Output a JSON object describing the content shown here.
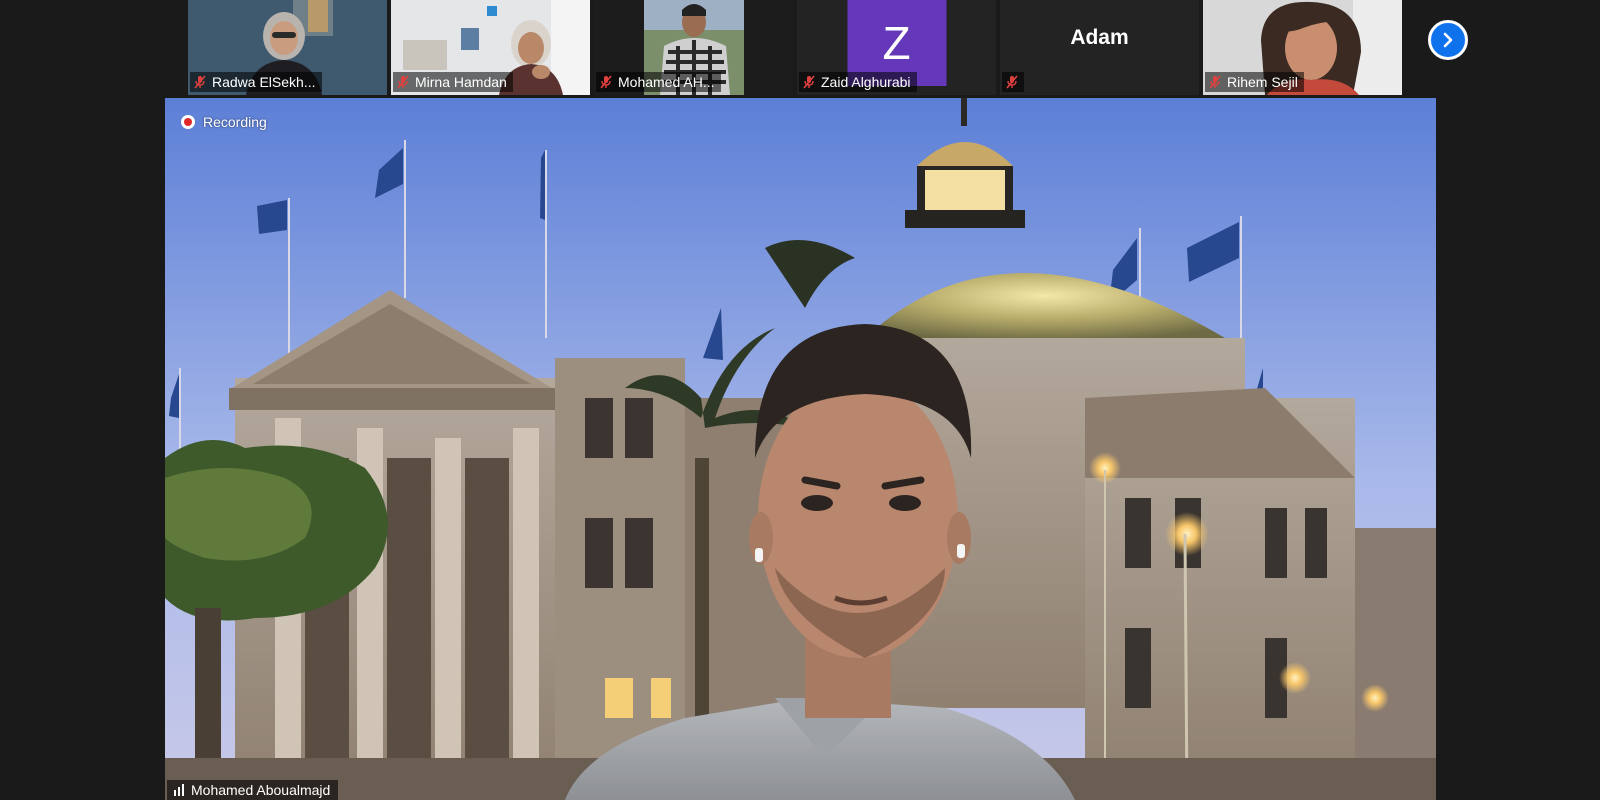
{
  "participants": [
    {
      "name": "Radwa ElSekh...",
      "mic": "muted-mic-icon"
    },
    {
      "name": "Mirna Hamdan",
      "mic": "muted-mic-icon"
    },
    {
      "name": "Mohamed AH...",
      "mic": "muted-mic-icon"
    },
    {
      "name": "Zaid Alghurabi",
      "avatar_letter": "Z",
      "avatar_color": "#6438b8",
      "mic": "muted-mic-icon"
    },
    {
      "name": "Adam",
      "mic": "muted-mic-icon"
    },
    {
      "name": "Rihem Sejil",
      "mic": "muted-mic-icon"
    }
  ],
  "navigation": {
    "next_icon": "chevron-right-icon",
    "accent": "#0e72ed"
  },
  "main": {
    "recording_label": "Recording",
    "recording_color": "#e02828",
    "speaker_name": "Mohamed Aboualmajd",
    "speaker_icon": "audio-bars-icon"
  }
}
